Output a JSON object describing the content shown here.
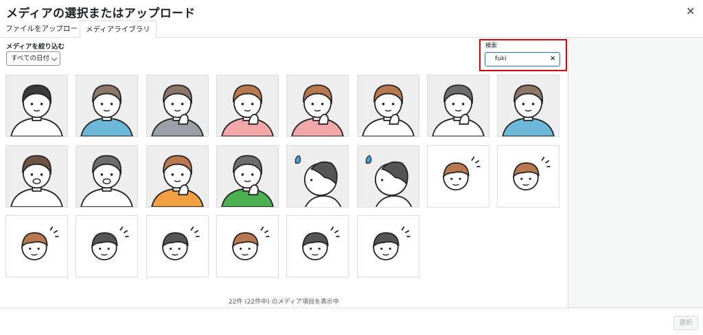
{
  "dialog": {
    "title": "メディアの選択またはアップロード",
    "close_icon": "×"
  },
  "tabs": [
    {
      "label": "ファイルをアップロード",
      "active": false
    },
    {
      "label": "メディアライブラリ",
      "active": true
    }
  ],
  "filter": {
    "label": "メディアを絞り込む",
    "date_select": "すべての日付"
  },
  "search": {
    "label": "検索",
    "value": "fuki",
    "clear_icon": "×"
  },
  "colors": {
    "highlight_border": "#d60000",
    "focus_border": "#2271b1"
  },
  "media_items": [
    {
      "name": "man-suit-black-hair",
      "hair": "#3a3a3a",
      "shirt": "#ffffff",
      "bg": "gray",
      "pose": "normal"
    },
    {
      "name": "man-brown-hair-blue",
      "hair": "#8b7768",
      "shirt": "#6bb8d8",
      "bg": "gray",
      "pose": "normal"
    },
    {
      "name": "woman-gray-cardigan",
      "hair": "#8b7768",
      "shirt": "#9aa0a6",
      "bg": "gray",
      "pose": "hand"
    },
    {
      "name": "woman-thinking-pink",
      "hair": "#b8794f",
      "shirt": "#f2a8a8",
      "bg": "gray",
      "pose": "chin"
    },
    {
      "name": "woman-worried-pink",
      "hair": "#b8794f",
      "shirt": "#f2a8a8",
      "bg": "gray",
      "pose": "chin"
    },
    {
      "name": "woman-thinking-white",
      "hair": "#b8794f",
      "shirt": "#ffffff",
      "bg": "gray",
      "pose": "chin"
    },
    {
      "name": "man-thinking-white",
      "hair": "#6d6d6d",
      "shirt": "#ffffff",
      "bg": "gray",
      "pose": "chin"
    },
    {
      "name": "woman-smile-blue",
      "hair": "#8b7768",
      "shirt": "#6bb8d8",
      "bg": "gray",
      "pose": "normal"
    },
    {
      "name": "woman-shock",
      "hair": "#6d5344",
      "shirt": "#ffffff",
      "bg": "gray",
      "pose": "shock"
    },
    {
      "name": "man-shock",
      "hair": "#6d6d6d",
      "shirt": "#ffffff",
      "bg": "gray",
      "pose": "shock"
    },
    {
      "name": "woman-thinking-orange",
      "hair": "#b8794f",
      "shirt": "#f0a040",
      "bg": "gray",
      "pose": "chin"
    },
    {
      "name": "man-thinking-green",
      "hair": "#6d6d6d",
      "shirt": "#4caf50",
      "bg": "gray",
      "pose": "chin"
    },
    {
      "name": "man-side-sweat",
      "hair": "#555555",
      "shirt": "#ffffff",
      "bg": "gray",
      "pose": "side"
    },
    {
      "name": "man-side-idea",
      "hair": "#555555",
      "shirt": "#ffffff",
      "bg": "gray",
      "pose": "side"
    },
    {
      "name": "woman-angry-fuki",
      "hair": "#b8794f",
      "shirt": "#ffffff",
      "bg": "white",
      "pose": "face"
    },
    {
      "name": "woman-confused-fuki",
      "hair": "#b8794f",
      "shirt": "#ffffff",
      "bg": "white",
      "pose": "face"
    },
    {
      "name": "woman-surprised-fuki",
      "hair": "#b8794f",
      "shirt": "#ffffff",
      "bg": "white",
      "pose": "face"
    },
    {
      "name": "man-worried-fuki",
      "hair": "#555555",
      "shirt": "#ffffff",
      "bg": "white",
      "pose": "face"
    },
    {
      "name": "man-angry-fuki",
      "hair": "#555555",
      "shirt": "#ffffff",
      "bg": "white",
      "pose": "face"
    },
    {
      "name": "woman-happy-fuki",
      "hair": "#b8794f",
      "shirt": "#ffffff",
      "bg": "white",
      "pose": "face"
    },
    {
      "name": "man-confused-fuki",
      "hair": "#555555",
      "shirt": "#ffffff",
      "bg": "white",
      "pose": "face"
    },
    {
      "name": "man-smile-fuki",
      "hair": "#555555",
      "shirt": "#ffffff",
      "bg": "white",
      "pose": "face"
    }
  ],
  "status": {
    "count_text": "22件 (22件中) のメディア項目を表示中"
  },
  "footer": {
    "select_label": "選択"
  }
}
